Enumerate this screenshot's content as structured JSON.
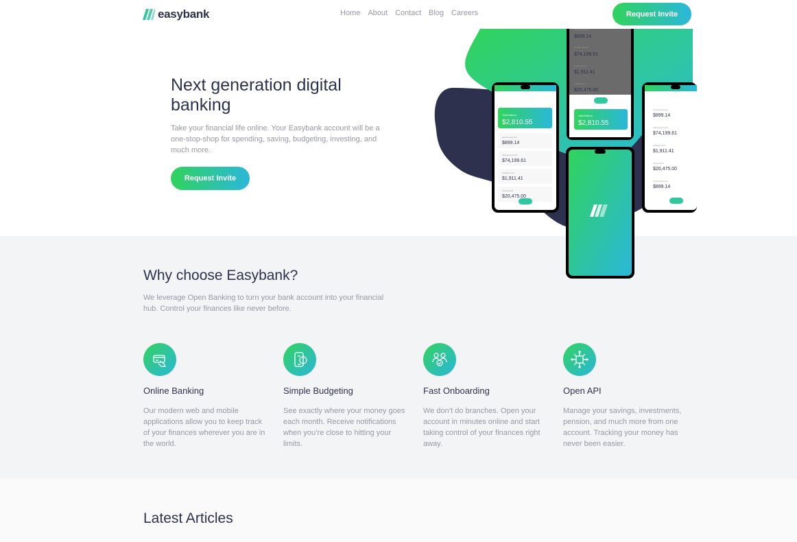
{
  "header": {
    "logo_text": "easybank",
    "nav": [
      "Home",
      "About",
      "Contact",
      "Blog",
      "Careers"
    ],
    "cta_label": "Request Invite"
  },
  "hero": {
    "title": "Next generation digital banking",
    "description": "Take your financial life online. Your Easybank account will be a one-stop-shop for spending, saving, budgeting, investing, and much more.",
    "cta_label": "Request Invite",
    "phones": {
      "balance_label": "Total Balance",
      "balance": "$2,810.55",
      "amounts": [
        "$899.14",
        "$74,199.61",
        "$1,911.41",
        "$20,475.00"
      ],
      "account_labels": [
        "Current Account",
        "Savings Account",
        "Holiday Fund",
        "Investments"
      ]
    }
  },
  "why": {
    "title": "Why choose Easybank?",
    "description": "We leverage Open Banking to turn your bank account into your financial hub. Control your finances like never before.",
    "features": [
      {
        "icon": "online-banking-icon",
        "title": "Online Banking",
        "description": "Our modern web and mobile applications allow you to keep track of your finances wherever you are in the world."
      },
      {
        "icon": "budgeting-icon",
        "title": "Simple Budgeting",
        "description": "See exactly where your money goes each month. Receive notifications when you’re close to hitting your limits."
      },
      {
        "icon": "onboarding-icon",
        "title": "Fast Onboarding",
        "description": "We don’t do branches. Open your account in minutes online and start taking control of your finances right away."
      },
      {
        "icon": "api-icon",
        "title": "Open API",
        "description": "Manage your savings, investments, pension, and much more from one account. Tracking your money has never been easier."
      }
    ]
  },
  "articles": {
    "title": "Latest Articles"
  },
  "colors": {
    "dark_blue": "#2d314d",
    "lime_green": "#31d35c",
    "bright_cyan": "#2bb7da",
    "grayish_blue": "#9698a6",
    "light_gray": "#f3f4f6"
  }
}
